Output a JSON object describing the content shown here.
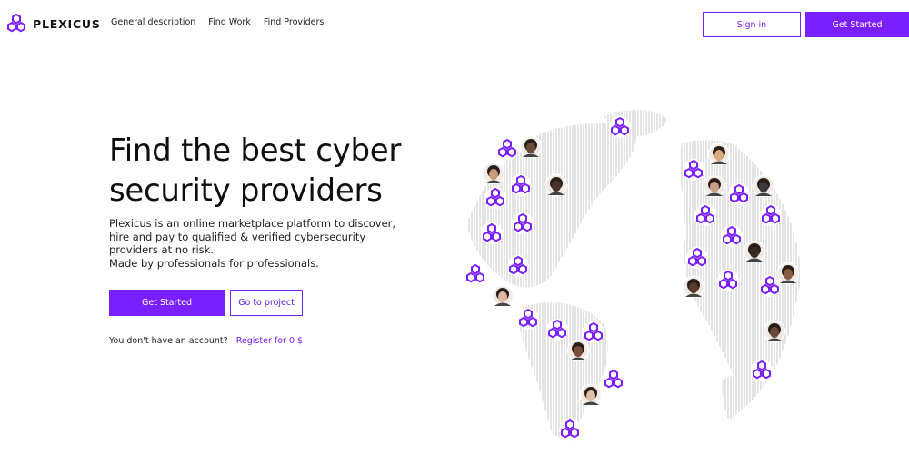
{
  "brand": {
    "name": "PLEXICUS",
    "accent": "#7a1fff"
  },
  "nav": {
    "items": [
      {
        "label": "General description"
      },
      {
        "label": "Find Work"
      },
      {
        "label": "Find Providers"
      }
    ]
  },
  "header": {
    "sign_in_label": "Sign in",
    "get_started_label": "Get Started"
  },
  "hero": {
    "title_line1": "Find the best cyber",
    "title_line2": "security providers",
    "description_lines": [
      "Plexicus is an online marketplace platform to discover,",
      "hire and pay to qualified & verified cybersecurity",
      "providers at no risk.",
      "Made by professionals for professionals."
    ],
    "primary_button": "Get Started",
    "secondary_button": "Go to project",
    "no_account_text": "You don't have an account?",
    "register_link": "Register for 0 $"
  },
  "globe": {
    "icons": [
      "plexicus-node-icon",
      "provider-avatar"
    ]
  }
}
